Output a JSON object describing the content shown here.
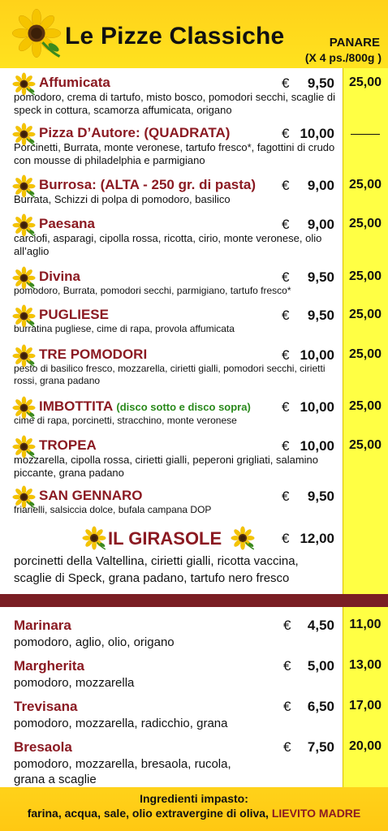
{
  "header": {
    "title": "Le Pizze Classiche",
    "panare_label": "PANARE",
    "panare_sub": "(X 4 ps./800g )"
  },
  "currency": "€",
  "pizze": [
    {
      "name": "Affumicata",
      "price": "9,50",
      "panare": "25,00",
      "desc": "pomodoro, crema di tartufo, misto bosco, pomodori secchi, scaglie di speck in cottura, scamorza affumicata, origano"
    },
    {
      "name": "Pizza D’Autore: (QUADRATA)",
      "price": "10,00",
      "panare": "",
      "desc": "Porcinetti, Burrata, monte veronese, tartufo fresco*, fagottini di crudo con mousse di philadelphia e parmigiano"
    },
    {
      "name": "Burrosa: (ALTA - 250 gr. di pasta)",
      "price": "9,00",
      "panare": "25,00",
      "desc": "Burrata, Schizzi di polpa di pomodoro, basilico"
    },
    {
      "name": "Paesana",
      "price": "9,00",
      "panare": "25,00",
      "desc": "carciofi, asparagi, cipolla rossa, ricotta, cirio, monte veronese, olio all’aglio"
    },
    {
      "name": "Divina",
      "price": "9,50",
      "panare": "25,00",
      "desc": "pomodoro, Burrata, pomodori secchi, parmigiano, tartufo fresco*"
    },
    {
      "name": "PUGLIESE",
      "price": "9,50",
      "panare": "25,00",
      "desc": "burratina pugliese, cime di rapa, provola affumicata"
    },
    {
      "name": "TRE POMODORI",
      "price": "10,00",
      "panare": "25,00",
      "desc": "pesto di basilico fresco, mozzarella, ciriettі gialli, pomodori secchi, ciriettі rossi, grana padano"
    },
    {
      "name": "IMBOTTITA",
      "note": "(disco sotto e disco sopra)",
      "price": "10,00",
      "panare": "25,00",
      "desc": "cime di rapa, porcinetti, stracchino, monte veronese"
    },
    {
      "name": "TROPEA",
      "price": "10,00",
      "panare": "25,00",
      "desc": "mozzarella, cipolla rossa, ciriettі gialli, peperoni grigliati, salamino piccante, grana padano"
    },
    {
      "name": "SAN GENNARO",
      "price": "9,50",
      "panare": "",
      "desc": "friarielli, salsiccia dolce, bufala campana DOP"
    }
  ],
  "special": {
    "name": "IL GIRASOLE",
    "price": "12,00",
    "desc": "porcinetti della Valtellina, ciriettі gialli, ricotta vaccina, scaglie di Speck, grana padano, tartufo nero fresco"
  },
  "classiche": [
    {
      "name": "Marinara",
      "price": "4,50",
      "panare": "11,00",
      "desc": "pomodoro, aglio, olio, origano"
    },
    {
      "name": "Margherita",
      "price": "5,00",
      "panare": "13,00",
      "desc": "pomodoro, mozzarella"
    },
    {
      "name": "Trevisana",
      "price": "6,50",
      "panare": "17,00",
      "desc": "pomodoro, mozzarella, radicchio, grana"
    },
    {
      "name": "Bresaola",
      "price": "7,50",
      "panare": "20,00",
      "desc": "pomodoro, mozzarella, bresaola, rucola, grana a scaglie"
    }
  ],
  "footer": {
    "line1": "Ingredienti impasto:",
    "line2": "farina, acqua, sale, olio extravergine di oliva,",
    "line2_red": "LIEVITO MADRE"
  },
  "colors": {
    "accent": "#8b1a22",
    "yellow": "#ffd21a",
    "panare_bg": "#ffff44",
    "note_green": "#2a8a1c"
  }
}
